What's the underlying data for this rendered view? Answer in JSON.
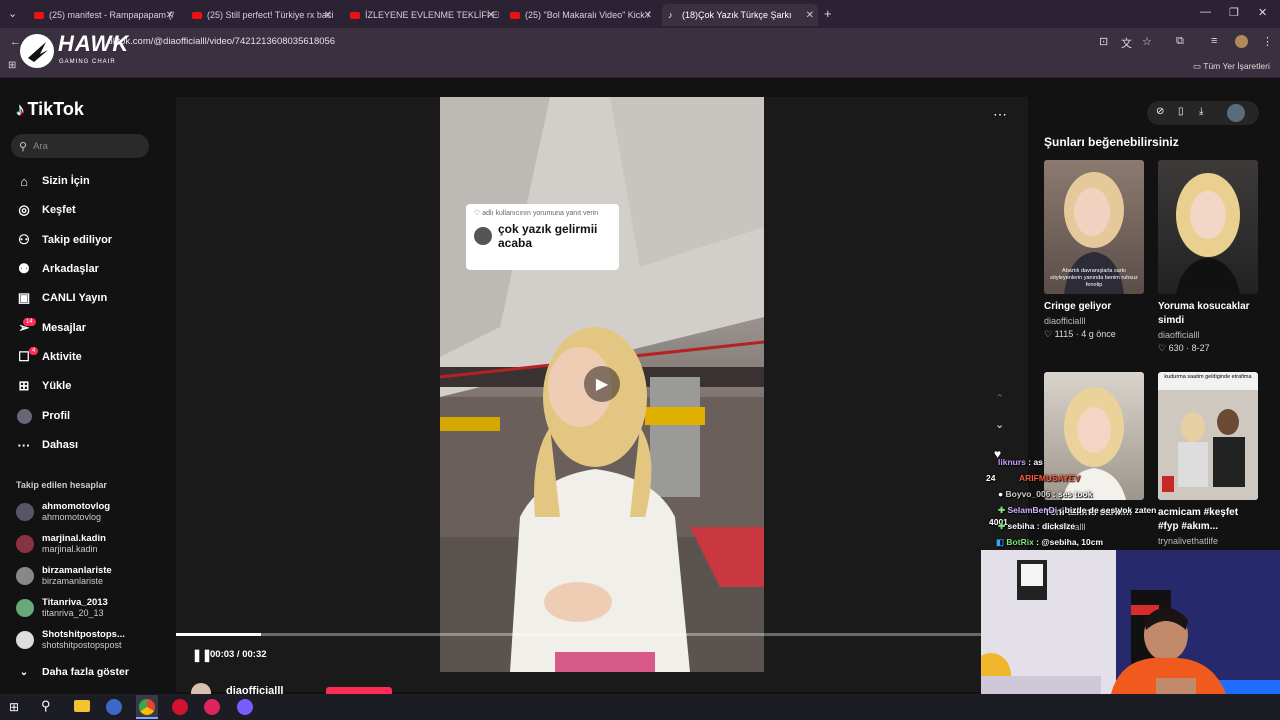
{
  "browser": {
    "tabs": [
      {
        "title": "(25) manifest - Rampapapam (/",
        "type": "youtube"
      },
      {
        "title": "(25) Still perfect! Türkiye rx baci",
        "type": "youtube"
      },
      {
        "title": "İZLEYENE EVLENME TEKLİFİ EDI",
        "type": "youtube"
      },
      {
        "title": "(25) \"Bol Makaralı Video\" Kick /",
        "type": "youtube"
      },
      {
        "title": "(18)Çok Yazık Türkçe Şarkı",
        "type": "tiktok",
        "active": true
      }
    ],
    "url": "tiktok.com/@diaofficialll/video/7421213608035618056",
    "bookmarks_label": "Tüm Yer İşaretleri"
  },
  "overlay_logo": {
    "brand": "HAWK",
    "sub": "GAMING CHAIR"
  },
  "tiktok": {
    "logo": "TikTok",
    "search_placeholder": "Ara",
    "nav": [
      {
        "label": "Sizin İçin",
        "icon": "home-icon"
      },
      {
        "label": "Keşfet",
        "icon": "compass-icon"
      },
      {
        "label": "Takip ediliyor",
        "icon": "following-icon"
      },
      {
        "label": "Arkadaşlar",
        "icon": "friends-icon"
      },
      {
        "label": "CANLI Yayın",
        "icon": "live-icon"
      },
      {
        "label": "Mesajlar",
        "icon": "messages-icon",
        "badge": "14"
      },
      {
        "label": "Aktivite",
        "icon": "activity-icon",
        "badge": "4"
      },
      {
        "label": "Yükle",
        "icon": "upload-icon"
      },
      {
        "label": "Profil",
        "icon": "profile-icon"
      },
      {
        "label": "Dahası",
        "icon": "more-icon"
      }
    ],
    "followed_header": "Takip edilen hesaplar",
    "followed": [
      {
        "name": "ahmomotovlog",
        "handle": "ahmomotovlog"
      },
      {
        "name": "marjinal.kadin",
        "handle": "marjinal.kadin"
      },
      {
        "name": "birzamanlariste",
        "handle": "birzamanlariste"
      },
      {
        "name": "Titanriva_2013",
        "handle": "titanriva_20_13"
      },
      {
        "name": "Shotshitpostops...",
        "handle": "shotshitpostopspost"
      }
    ],
    "show_more": "Daha fazla göster"
  },
  "video": {
    "comment_header": "adlı kullanıcının yorumuna yanıt verin",
    "comment_text": "çok yazık gelirmii acaba",
    "time": "00:03 / 00:32",
    "progress": 0.1,
    "author": "diaofficialll"
  },
  "suggestions": {
    "title": "Şunları beğenebilirsiniz",
    "cards": [
      {
        "title": "Cringe geliyor",
        "user": "diaofficialll",
        "likes": "1115",
        "date": "4 g önce",
        "caption": "Abartılı davranışlarla sarkı söyleyenlerin yanında benim ruhsuz fenotip"
      },
      {
        "title": "Yoruma kosucaklar simdi",
        "user": "diaofficialll",
        "likes": "630",
        "date": "8-27",
        "caption": ""
      },
      {
        "title": "Yeni takıntı sarkim",
        "user": "diaofficialll",
        "likes": "",
        "date": "",
        "caption": ""
      },
      {
        "title": "acmicam #keşfet #fyp #akım...",
        "user": "trynalivethatlife",
        "likes": "",
        "date": "",
        "caption": "kudurma saatim geldiginde etrafima"
      }
    ]
  },
  "stream_chat": [
    {
      "user": "liknurs",
      "msg": "as",
      "color": "#c8a0ff"
    },
    {
      "user": "ARIFMUSAYEV",
      "msg": "",
      "color": "#ff5a3c"
    },
    {
      "user": "Boyvo_006",
      "msg": "ses took",
      "color": "#cfcfcf"
    },
    {
      "user": "SelamBenDi",
      "msg": "bizde de ses yok zaten",
      "color": "#d6b4ff"
    },
    {
      "user": "sebiha",
      "msg": "dickslze",
      "color": "#ffffff"
    },
    {
      "user": "BotRix",
      "msg": "@sebiha, 10cm",
      "color": "#7de37d"
    }
  ],
  "stream_counters": [
    "24",
    "4001"
  ]
}
